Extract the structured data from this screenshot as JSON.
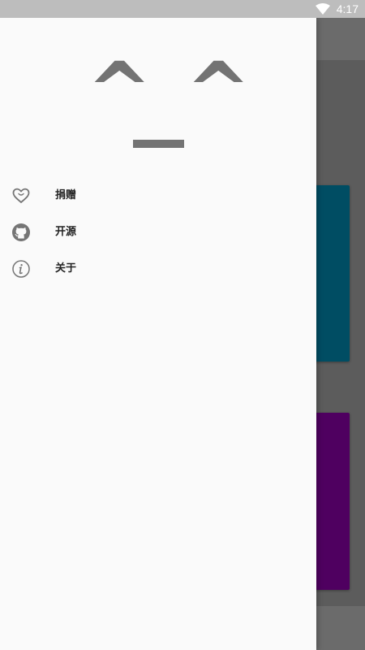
{
  "status_bar": {
    "time": "4:17",
    "wifi_icon": "wifi-icon"
  },
  "drawer": {
    "header": {
      "left_eye": "^",
      "right_eye": "^"
    },
    "menu_items": [
      {
        "label": "捐赠",
        "icon": "heart-icon"
      },
      {
        "label": "开源",
        "icon": "github-icon"
      },
      {
        "label": "关于",
        "icon": "info-icon"
      }
    ]
  },
  "colors": {
    "card_1": "#004d63",
    "card_2": "#4f0060"
  }
}
